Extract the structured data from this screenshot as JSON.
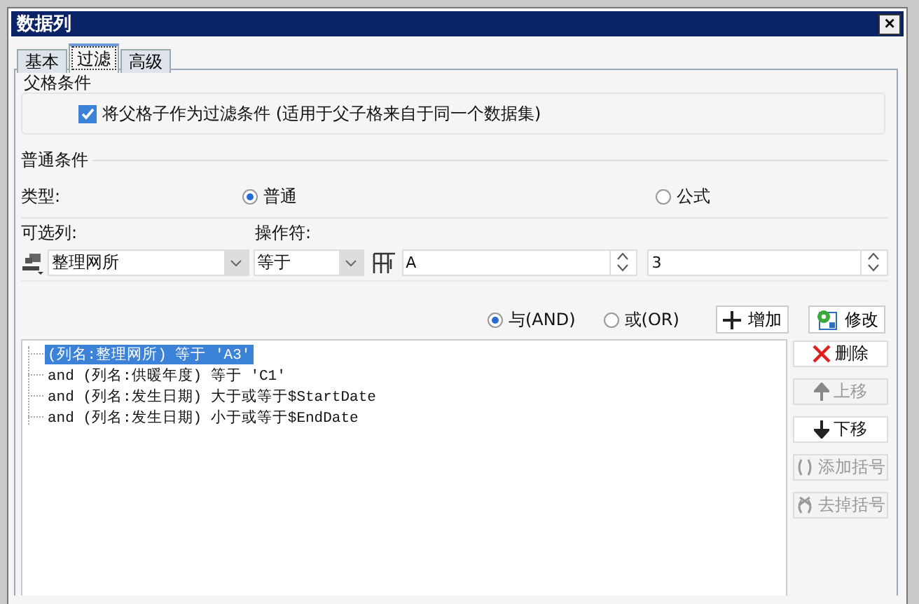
{
  "window": {
    "title": "数据列",
    "close": "×"
  },
  "tabs": [
    {
      "label": "基本",
      "selected": false
    },
    {
      "label": "过滤",
      "selected": true
    },
    {
      "label": "高级",
      "selected": false
    }
  ],
  "parent_condition": {
    "title": "父格条件",
    "checkbox": {
      "label": "将父格子作为过滤条件 (适用于父子格来自于同一个数据集)",
      "checked": true
    }
  },
  "normal_condition": {
    "title": "普通条件",
    "type_label": "类型:",
    "type_options": [
      {
        "label": "普通",
        "selected": true
      },
      {
        "label": "公式",
        "selected": false
      }
    ],
    "column_label": "可选列:",
    "operator_label": "操作符:",
    "column_value": "整理网所",
    "operator_value": "等于",
    "value_a": "A",
    "value_b": "3"
  },
  "logic_options": [
    {
      "label": "与(AND)",
      "selected": true
    },
    {
      "label": "或(OR)",
      "selected": false
    }
  ],
  "toolbar_buttons": [
    {
      "kind": "add",
      "label": "增加"
    },
    {
      "kind": "edit",
      "label": "修改"
    }
  ],
  "conditions": [
    {
      "text": "(列名:整理网所) 等于 'A3'",
      "selected": true
    },
    {
      "text": "and (列名:供暖年度) 等于 'C1'",
      "selected": false
    },
    {
      "text": "and (列名:发生日期) 大于或等于$StartDate",
      "selected": false
    },
    {
      "text": "and (列名:发生日期) 小于或等于$EndDate",
      "selected": false
    }
  ],
  "side_buttons": [
    {
      "kind": "delete",
      "label": "删除",
      "disabled": false
    },
    {
      "kind": "up",
      "label": "上移",
      "disabled": true
    },
    {
      "kind": "down",
      "label": "下移",
      "disabled": false
    },
    {
      "kind": "add-bracket",
      "label": "添加括号",
      "disabled": true
    },
    {
      "kind": "remove-bracket",
      "label": "去掉括号",
      "disabled": true
    }
  ]
}
